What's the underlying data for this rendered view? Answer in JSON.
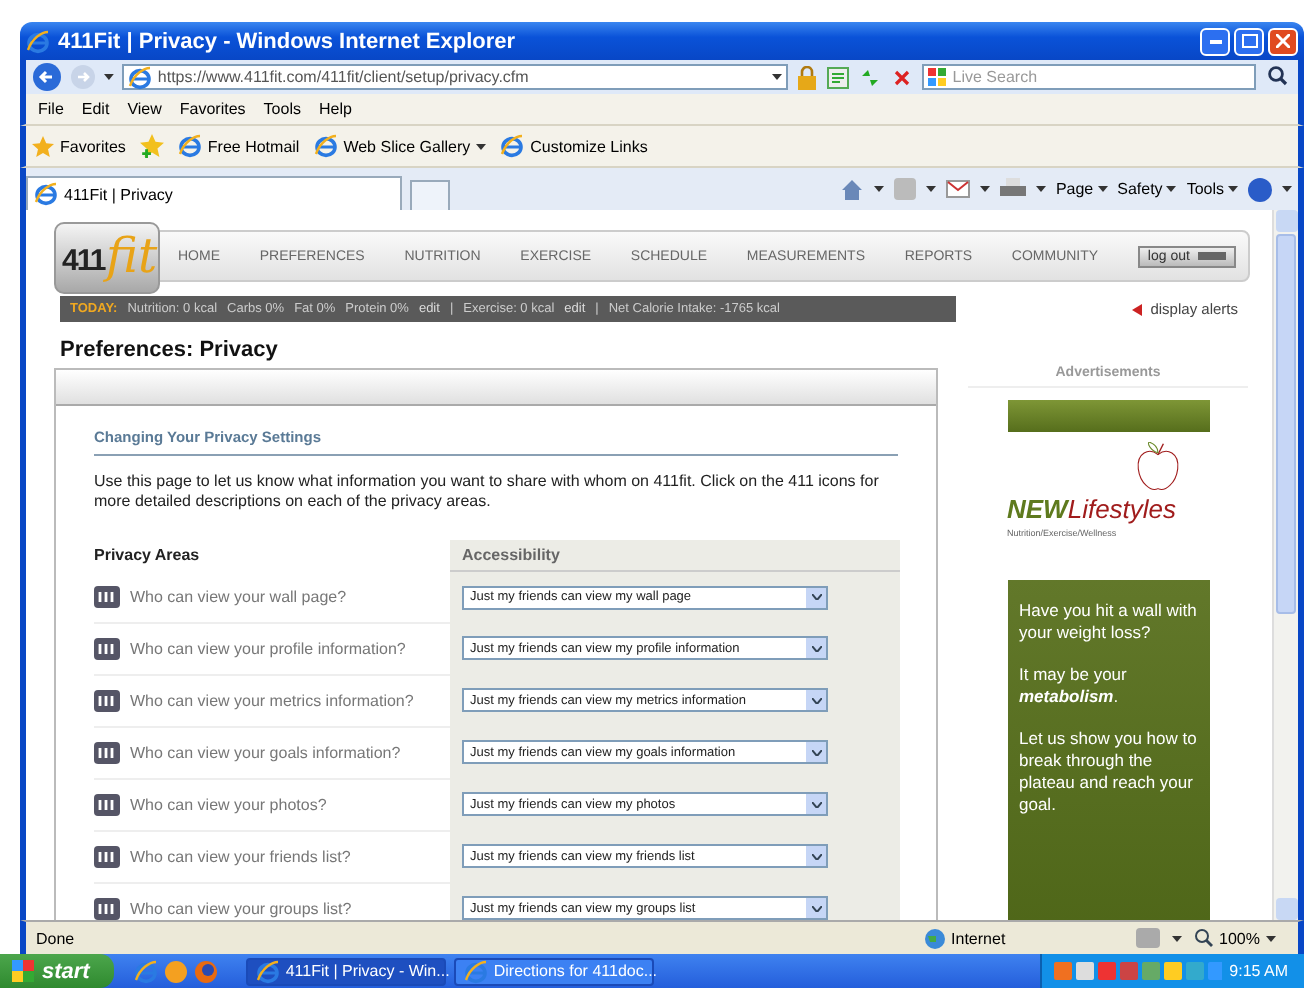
{
  "window": {
    "title": "411Fit | Privacy - Windows Internet Explorer"
  },
  "address_bar": {
    "url": "https://www.411fit.com/411fit/client/setup/privacy.cfm"
  },
  "search": {
    "placeholder": "Live Search"
  },
  "menu": [
    "File",
    "Edit",
    "View",
    "Favorites",
    "Tools",
    "Help"
  ],
  "favorites_bar": {
    "label": "Favorites",
    "links": [
      {
        "label": "Free Hotmail",
        "kind": "link"
      },
      {
        "label": "Web Slice Gallery",
        "kind": "dropdown"
      },
      {
        "label": "Customize Links",
        "kind": "link"
      }
    ]
  },
  "tabs": [
    {
      "label": "411Fit | Privacy",
      "selected": true
    }
  ],
  "command_bar": [
    "Page",
    "Safety",
    "Tools"
  ],
  "site": {
    "logo": {
      "digits": "411",
      "word": "fit"
    },
    "nav": [
      "HOME",
      "PREFERENCES",
      "NUTRITION",
      "EXERCISE",
      "SCHEDULE",
      "MEASUREMENTS",
      "REPORTS",
      "COMMUNITY"
    ],
    "logout": "log out",
    "today": {
      "label": "TODAY:",
      "items": [
        {
          "text": "Nutrition: 0 kcal",
          "kind": "text"
        },
        {
          "text": "Carbs 0%",
          "kind": "text"
        },
        {
          "text": "Fat 0%",
          "kind": "text"
        },
        {
          "text": "Protein 0%",
          "kind": "text"
        },
        {
          "text": "edit",
          "kind": "link"
        },
        {
          "text": "|",
          "kind": "separator"
        },
        {
          "text": "Exercise: 0 kcal",
          "kind": "text"
        },
        {
          "text": "edit",
          "kind": "link"
        },
        {
          "text": "|",
          "kind": "separator"
        },
        {
          "text": "Net Calorie Intake: -1765 kcal",
          "kind": "text"
        }
      ]
    },
    "alerts_link": "display alerts",
    "heading": "Preferences: Privacy",
    "section_title": "Changing Your Privacy Settings",
    "description": "Use this page to let us know what information you want to share with whom on 411fit. Click on the 411 icons for more detailed descriptions on each of the privacy areas.",
    "table": {
      "columns": [
        "Privacy Areas",
        "Accessibility"
      ],
      "rows": [
        {
          "question": "Who can view your wall page?",
          "value": "Just my friends can view my wall page"
        },
        {
          "question": "Who can view your profile information?",
          "value": "Just my friends can view my profile information"
        },
        {
          "question": "Who can view your metrics information?",
          "value": "Just my friends can view my metrics information"
        },
        {
          "question": "Who can view your goals information?",
          "value": "Just my friends can view my goals information"
        },
        {
          "question": "Who can view your photos?",
          "value": "Just my friends can view my photos"
        },
        {
          "question": "Who can view your friends list?",
          "value": "Just my friends can view my friends list"
        },
        {
          "question": "Who can view your groups list?",
          "value": "Just my friends can view my groups list"
        }
      ]
    },
    "ads": {
      "heading": "Advertisements",
      "brand": {
        "new": "NEW",
        "name": "Lifestyles",
        "tagline": "Nutrition/Exercise/Wellness"
      },
      "paragraphs": [
        "Have you hit a wall with your weight loss?",
        "It may be your **metabolism**.",
        "Let us show you how to break through the plateau and reach your goal."
      ]
    }
  },
  "status_bar": {
    "text": "Done",
    "zone": "Internet",
    "zoom": "100%"
  },
  "taskbar": {
    "start": "start",
    "tasks": [
      {
        "label": "411Fit | Privacy - Win...",
        "selected": true
      },
      {
        "label": "Directions for 411doc...",
        "selected": false
      }
    ],
    "clock": "9:15 AM"
  }
}
